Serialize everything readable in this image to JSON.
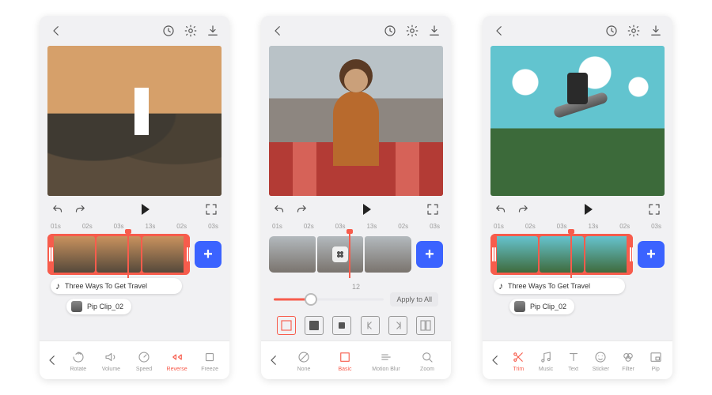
{
  "icons": {
    "back": "back-icon",
    "history": "history-icon",
    "settings": "settings-icon",
    "download": "download-icon",
    "undo": "undo-icon",
    "redo": "redo-icon",
    "play": "play-icon",
    "fullscreen": "fullscreen-icon",
    "add": "add-icon",
    "note": "note-icon"
  },
  "ruler": [
    "01s",
    "02s",
    "03s",
    "13s",
    "02s",
    "03s"
  ],
  "screen1": {
    "chips": {
      "music": "Three Ways To Get Travel",
      "pip": "Pip Clip_02"
    },
    "nav": [
      {
        "id": "rotate",
        "label": "Rotate"
      },
      {
        "id": "volume",
        "label": "Volume"
      },
      {
        "id": "speed",
        "label": "Speed"
      },
      {
        "id": "reverse",
        "label": "Reverse",
        "active": true
      },
      {
        "id": "freeze",
        "label": "Freeze"
      }
    ]
  },
  "screen2": {
    "slider": {
      "label": "12",
      "apply": "Apply to All"
    },
    "frames": [
      "full",
      "center",
      "square",
      "skipback",
      "skipfwd",
      "split"
    ],
    "nav": [
      {
        "id": "none",
        "label": "None"
      },
      {
        "id": "basic",
        "label": "Basic",
        "active": true
      },
      {
        "id": "motionblur",
        "label": "Motion Blur"
      },
      {
        "id": "zoom",
        "label": "Zoom"
      }
    ]
  },
  "screen3": {
    "chips": {
      "music": "Three Ways To Get Travel",
      "pip": "Pip Clip_02"
    },
    "nav": [
      {
        "id": "trim",
        "label": "Trim",
        "active": true
      },
      {
        "id": "music",
        "label": "Music"
      },
      {
        "id": "text",
        "label": "Text"
      },
      {
        "id": "sticker",
        "label": "Sticker"
      },
      {
        "id": "filter",
        "label": "Filter"
      },
      {
        "id": "pip",
        "label": "Pip"
      }
    ]
  },
  "add_label": "+"
}
